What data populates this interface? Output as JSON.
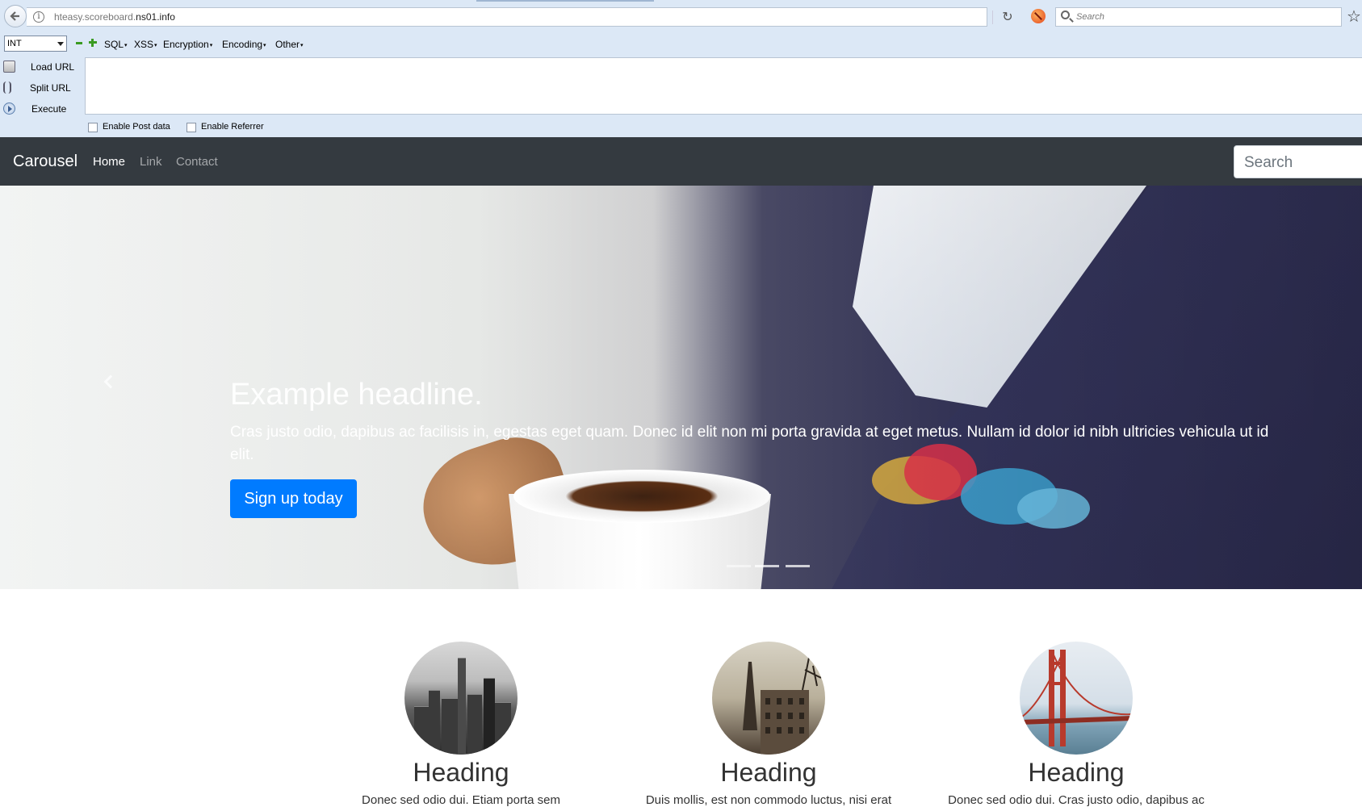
{
  "browser": {
    "url_prefix": "hteasy.scoreboard.",
    "url_domain": "ns01.info",
    "search_placeholder": "Search"
  },
  "hackbar": {
    "select_value": "INT",
    "menus": [
      "SQL",
      "XSS",
      "Encryption",
      "Encoding",
      "Other"
    ],
    "actions": [
      "Load URL",
      "Split URL",
      "Execute"
    ],
    "checkboxes": [
      "Enable Post data",
      "Enable Referrer"
    ]
  },
  "site": {
    "brand": "Carousel",
    "nav": [
      "Home",
      "Link",
      "Contact"
    ],
    "search_placeholder": "Search",
    "carousel": {
      "headline": "Example headline.",
      "text": "Cras justo odio, dapibus ac facilisis in, egestas eget quam. Donec id elit non mi porta gravida at eget metus. Nullam id dolor id nibh ultricies vehicula ut id elit.",
      "button": "Sign up today"
    },
    "columns": [
      {
        "heading": "Heading",
        "text": "Donec sed odio dui. Etiam porta sem"
      },
      {
        "heading": "Heading",
        "text": "Duis mollis, est non commodo luctus, nisi erat"
      },
      {
        "heading": "Heading",
        "text": "Donec sed odio dui. Cras justo odio, dapibus ac"
      }
    ]
  }
}
